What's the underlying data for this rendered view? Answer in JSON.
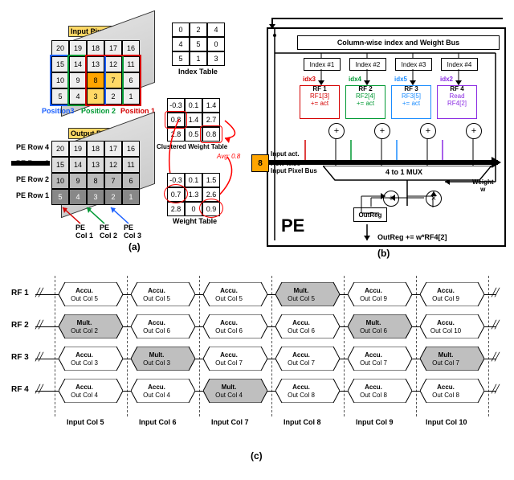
{
  "partA": {
    "input_title": "Input Pixels",
    "output_title": "Output Pixels",
    "input_grid": [
      [
        20,
        19,
        18,
        17,
        16
      ],
      [
        15,
        14,
        13,
        12,
        11
      ],
      [
        10,
        9,
        8,
        7,
        6
      ],
      [
        5,
        4,
        3,
        2,
        1
      ]
    ],
    "output_grid": [
      [
        20,
        19,
        18,
        17,
        16
      ],
      [
        15,
        14,
        13,
        12,
        11
      ],
      [
        10,
        9,
        8,
        7,
        6
      ],
      [
        5,
        4,
        3,
        2,
        1
      ]
    ],
    "pos_labels": {
      "p3": "Position3",
      "p2": "Position 2",
      "p1": "Position 1"
    },
    "pe_row_labels": [
      "PE Row 4",
      "PE Row 3",
      "PE Row 2",
      "PE Row 1"
    ],
    "pe_col_labels": [
      "PE\nCol 1",
      "PE\nCol 2",
      "PE\nCol 3"
    ],
    "index_table_title": "Index Table",
    "index_table": [
      [
        0,
        2,
        4
      ],
      [
        4,
        5,
        0
      ],
      [
        5,
        1,
        3
      ]
    ],
    "clustered_title": "Clustered Weight Table",
    "clustered_table": [
      [
        -0.3,
        0.1,
        1.4
      ],
      [
        0.8,
        1.4,
        2.7
      ],
      [
        2.8,
        0.5,
        0.8
      ]
    ],
    "avg_annot": "Avg: 0.8",
    "weight_table_title": "Weight Table",
    "weight_table": [
      [
        -0.3,
        0.1,
        1.5
      ],
      [
        0.7,
        1.3,
        2.6
      ],
      [
        2.8,
        0,
        0.9
      ]
    ]
  },
  "partB": {
    "top_bus": "Column-wise index and Weight Bus",
    "index_boxes": [
      "Index #1",
      "Index #2",
      "Index #3",
      "Index #4"
    ],
    "idx_labels": [
      "idx3",
      "idx4",
      "idx5",
      "idx2"
    ],
    "idx_colors": [
      "#d40000",
      "#009933",
      "#1a8cff",
      "#8a2be2"
    ],
    "rf": [
      {
        "name": "RF 1",
        "line2": "RF1[3]",
        "op": "+= act"
      },
      {
        "name": "RF 2",
        "line2": "RF2[4]",
        "op": "+= act"
      },
      {
        "name": "RF 3",
        "line2": "RF3[5]",
        "op": "+= act"
      },
      {
        "name": "RF 4",
        "line2": "Read",
        "op": "RF4[2]"
      }
    ],
    "left_labels": {
      "input_act": "Input act.",
      "row_bus1": "Row-wise",
      "row_bus2": "Input Pixel Bus"
    },
    "mux": "4 to 1 MUX",
    "weight_w": "Weight\nw",
    "outreg": "OutReg",
    "pe": "PE",
    "eq": "OutReg += w*RF4[2]",
    "pixel": "8"
  },
  "partC": {
    "row_labels": [
      "RF 1",
      "RF 2",
      "RF 3",
      "RF 4"
    ],
    "col_labels": [
      "Input Col 5",
      "Input Col 6",
      "Input Col 7",
      "Input Col 8",
      "Input Col 9",
      "Input Col 10"
    ],
    "cells": [
      [
        {
          "t": "Accu.",
          "s": "Out Col 5",
          "m": 0
        },
        {
          "t": "Accu.",
          "s": "Out Col 5",
          "m": 0
        },
        {
          "t": "Accu.",
          "s": "Out Col 5",
          "m": 0
        },
        {
          "t": "Mult.",
          "s": "Out Col 5",
          "m": 1
        },
        {
          "t": "Accu.",
          "s": "Out Col 9",
          "m": 0
        },
        {
          "t": "Accu.",
          "s": "Out Col 9",
          "m": 0
        }
      ],
      [
        {
          "t": "Mult.",
          "s": "Out Col 2",
          "m": 1
        },
        {
          "t": "Accu.",
          "s": "Out Col 6",
          "m": 0
        },
        {
          "t": "Accu.",
          "s": "Out Col 6",
          "m": 0
        },
        {
          "t": "Accu.",
          "s": "Out Col 6",
          "m": 0
        },
        {
          "t": "Mult.",
          "s": "Out Col 6",
          "m": 1
        },
        {
          "t": "Accu.",
          "s": "Out Col 10",
          "m": 0
        }
      ],
      [
        {
          "t": "Accu.",
          "s": "Out Col 3",
          "m": 0
        },
        {
          "t": "Mult.",
          "s": "Out Col 3",
          "m": 1
        },
        {
          "t": "Accu.",
          "s": "Out Col 7",
          "m": 0
        },
        {
          "t": "Accu.",
          "s": "Out Col 7",
          "m": 0
        },
        {
          "t": "Accu.",
          "s": "Out Col 7",
          "m": 0
        },
        {
          "t": "Mult.",
          "s": "Out Col 7",
          "m": 1
        }
      ],
      [
        {
          "t": "Accu.",
          "s": "Out Col 4",
          "m": 0
        },
        {
          "t": "Accu.",
          "s": "Out Col 4",
          "m": 0
        },
        {
          "t": "Mult.",
          "s": "Out Col 4",
          "m": 1
        },
        {
          "t": "Accu.",
          "s": "Out Col 8",
          "m": 0
        },
        {
          "t": "Accu.",
          "s": "Out Col 8",
          "m": 0
        },
        {
          "t": "Accu.",
          "s": "Out Col 8",
          "m": 0
        }
      ]
    ]
  },
  "labels": {
    "a": "(a)",
    "b": "(b)",
    "c": "(c)"
  }
}
